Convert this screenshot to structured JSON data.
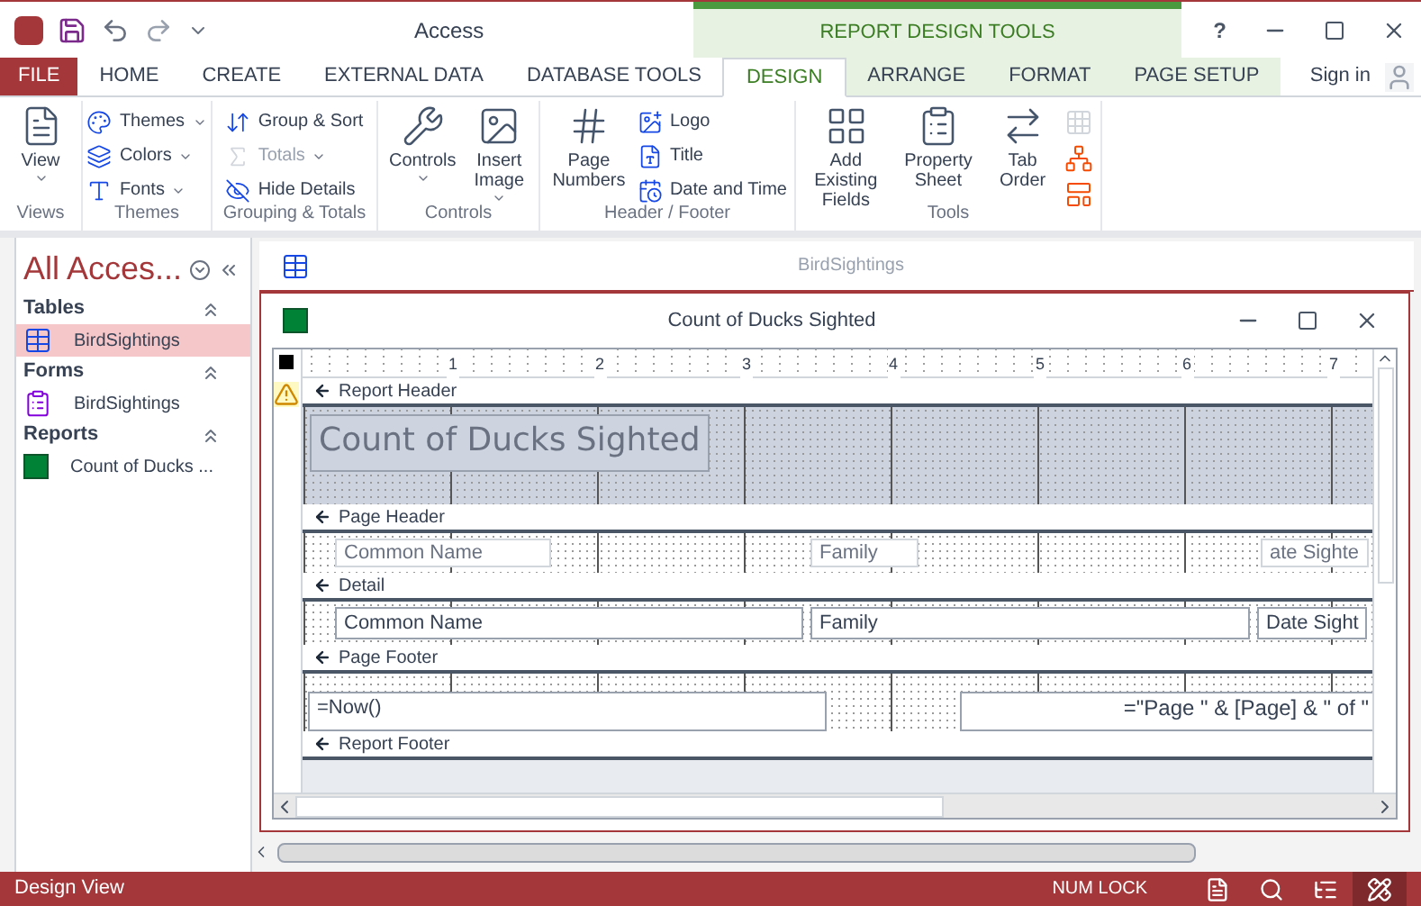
{
  "window": {
    "title": "Access",
    "context_group": "REPORT DESIGN TOOLS",
    "help": "?"
  },
  "tabs": [
    {
      "label": "FILE",
      "kind": "file",
      "selected": false
    },
    {
      "label": "HOME",
      "kind": "normal",
      "selected": false
    },
    {
      "label": "CREATE",
      "kind": "normal",
      "selected": false
    },
    {
      "label": "EXTERNAL DATA",
      "kind": "normal",
      "selected": false
    },
    {
      "label": "DATABASE TOOLS",
      "kind": "normal",
      "selected": false
    },
    {
      "label": "DESIGN",
      "kind": "contextual",
      "selected": true
    },
    {
      "label": "ARRANGE",
      "kind": "contextual",
      "selected": false
    },
    {
      "label": "FORMAT",
      "kind": "contextual",
      "selected": false
    },
    {
      "label": "PAGE SETUP",
      "kind": "contextual",
      "selected": false
    }
  ],
  "account": {
    "label": "Sign in"
  },
  "ribbon": {
    "groups": [
      {
        "label": "Views",
        "commands": [
          {
            "label": "View",
            "kind": "large",
            "dropdown": true,
            "disabled": false
          }
        ]
      },
      {
        "label": "Themes",
        "commands": [
          {
            "label": "Themes",
            "kind": "small",
            "dropdown": true,
            "disabled": false
          },
          {
            "label": "Colors",
            "kind": "small",
            "dropdown": true,
            "disabled": false
          },
          {
            "label": "Fonts",
            "kind": "small",
            "dropdown": true,
            "disabled": false
          }
        ]
      },
      {
        "label": "Grouping & Totals",
        "commands": [
          {
            "label": "Group & Sort",
            "kind": "small",
            "dropdown": false,
            "disabled": false
          },
          {
            "label": "Totals",
            "kind": "small",
            "dropdown": true,
            "disabled": true
          },
          {
            "label": "Hide Details",
            "kind": "small",
            "dropdown": false,
            "disabled": false
          }
        ]
      },
      {
        "label": "Controls",
        "commands": [
          {
            "label": "Controls",
            "kind": "large",
            "dropdown": true,
            "disabled": false
          },
          {
            "label": "Insert Image",
            "kind": "large",
            "dropdown": true,
            "disabled": false
          }
        ]
      },
      {
        "label": "Header / Footer",
        "commands": [
          {
            "label": "Page Numbers",
            "kind": "large",
            "dropdown": false,
            "disabled": false
          },
          {
            "label": "Logo",
            "kind": "small",
            "dropdown": false,
            "disabled": false
          },
          {
            "label": "Title",
            "kind": "small",
            "dropdown": false,
            "disabled": false
          },
          {
            "label": "Date and Time",
            "kind": "small",
            "dropdown": false,
            "disabled": false
          }
        ]
      },
      {
        "label": "Tools",
        "commands": [
          {
            "label": "Add Existing Fields",
            "kind": "large",
            "dropdown": false,
            "disabled": false
          },
          {
            "label": "Property Sheet",
            "kind": "large",
            "dropdown": false,
            "disabled": false
          },
          {
            "label": "Tab Order",
            "kind": "large",
            "dropdown": false,
            "disabled": false
          },
          {
            "kind": "icon",
            "disabled": true
          },
          {
            "kind": "icon",
            "disabled": false
          },
          {
            "kind": "icon",
            "disabled": false
          }
        ]
      }
    ]
  },
  "nav_pane": {
    "title": "All Acces...",
    "groups": [
      {
        "label": "Tables",
        "items": [
          {
            "label": "BirdSightings",
            "kind": "table",
            "selected": true
          }
        ]
      },
      {
        "label": "Forms",
        "items": [
          {
            "label": "BirdSightings",
            "kind": "form",
            "selected": false
          }
        ]
      },
      {
        "label": "Reports",
        "items": [
          {
            "label": "Count of Ducks ...",
            "kind": "report",
            "selected": false
          }
        ]
      }
    ]
  },
  "background_window": {
    "title": "BirdSightings"
  },
  "report_window": {
    "title": "Count of Ducks Sighted",
    "ruler": [
      "1",
      "2",
      "3",
      "4",
      "5",
      "6",
      "7"
    ],
    "sections": [
      {
        "title": "Report Header",
        "kind": "report_header",
        "controls": [
          {
            "text": "Count of Ducks Sighted",
            "kind": "title"
          }
        ]
      },
      {
        "title": "Page Header",
        "kind": "page_header",
        "controls": [
          {
            "text": "Common Name",
            "kind": "label"
          },
          {
            "text": "Family",
            "kind": "label"
          },
          {
            "text": "ate Sighte",
            "kind": "label"
          }
        ]
      },
      {
        "title": "Detail",
        "kind": "detail",
        "controls": [
          {
            "text": "Common Name",
            "kind": "textbox"
          },
          {
            "text": "Family",
            "kind": "textbox"
          },
          {
            "text": "Date Sight",
            "kind": "textbox"
          }
        ]
      },
      {
        "title": "Page Footer",
        "kind": "page_footer",
        "controls": [
          {
            "text": "=Now()",
            "kind": "textbox"
          },
          {
            "text": "=\"Page \" & [Page] & \" of \"",
            "kind": "textbox_right"
          }
        ]
      },
      {
        "title": "Report Footer",
        "kind": "report_footer"
      }
    ]
  },
  "status_bar": {
    "text": "Design View",
    "indicator": "NUM LOCK",
    "views": [
      {
        "kind": "report",
        "selected": false
      },
      {
        "kind": "print_preview",
        "selected": false
      },
      {
        "kind": "layout",
        "selected": false
      },
      {
        "kind": "design",
        "selected": true
      }
    ]
  }
}
